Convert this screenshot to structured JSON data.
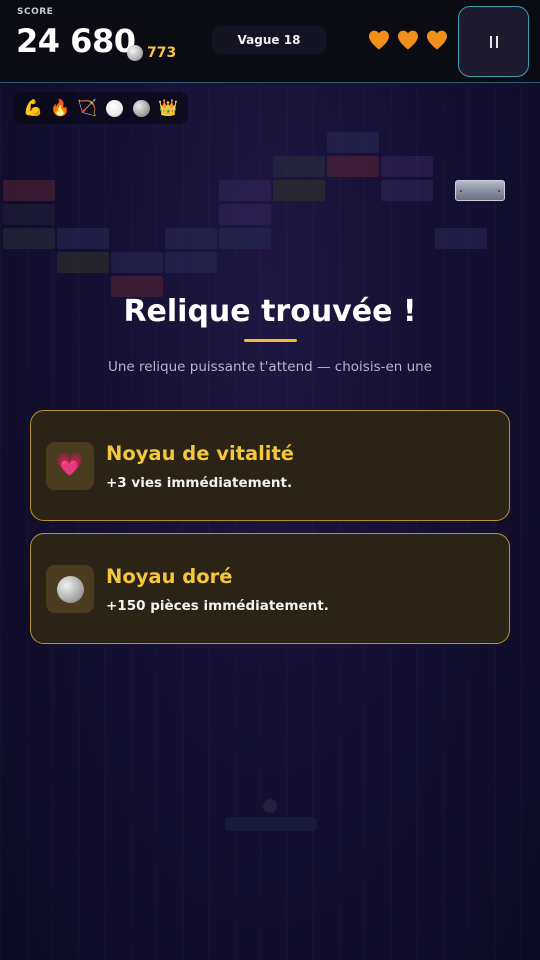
{
  "hud": {
    "score_label": "SCORE",
    "score": "24 680",
    "coins": "773",
    "wave": "Vague 18",
    "lives": 3,
    "lives_icon": "orange-heart-icon",
    "heart_color": "#f0901a",
    "pause_icon": "pause-icon"
  },
  "relic_bar": {
    "items": [
      "💪",
      "🔥",
      "🏹",
      "white-orb",
      "grey-orb",
      "👑"
    ]
  },
  "overlay": {
    "title": "Relique trouvée !",
    "subtitle": "Une relique puissante t'attend — choisis-en une",
    "accent": "#f0c030"
  },
  "choices": [
    {
      "icon": "💗",
      "name": "Noyau de vitalité",
      "desc": "+3 vies immédiatement."
    },
    {
      "icon": "grey-orb",
      "name": "Noyau doré",
      "desc": "+150 pièces immédiatement."
    }
  ]
}
